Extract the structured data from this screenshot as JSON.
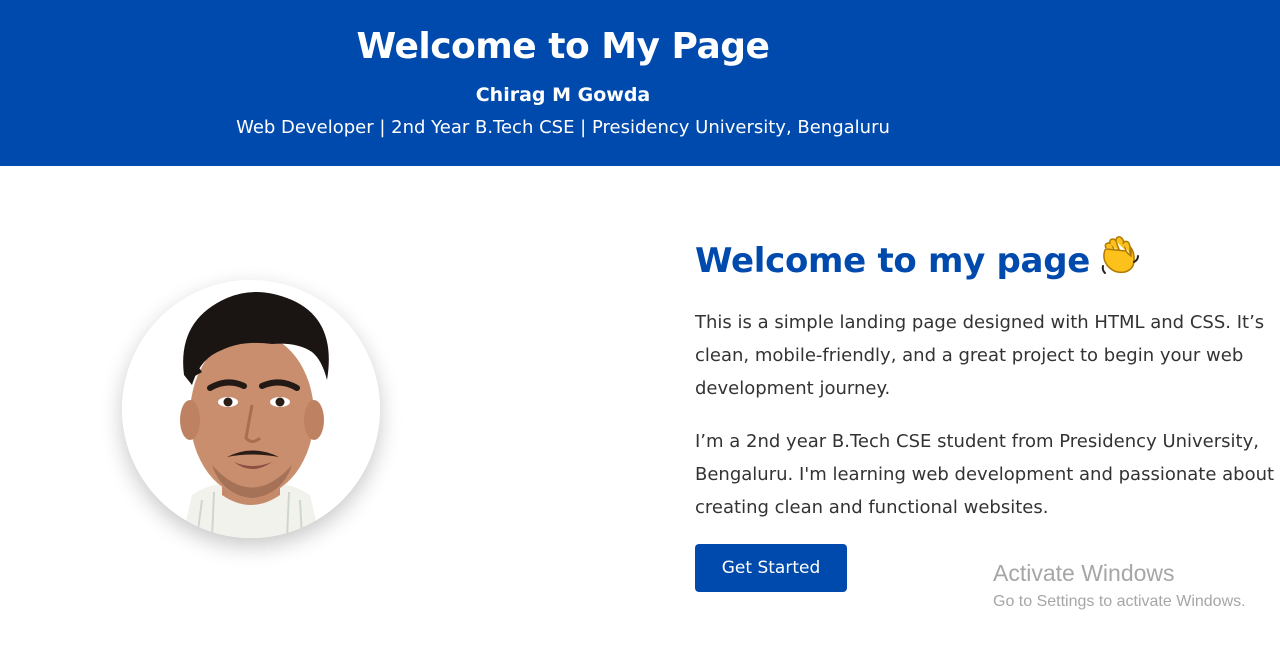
{
  "header": {
    "title": "Welcome to My Page",
    "name": "Chirag M Gowda",
    "tagline": "Web Developer | 2nd Year B.Tech CSE | Presidency University, Bengaluru"
  },
  "main": {
    "avatar_icon": "profile-photo",
    "heading": "Welcome to my page",
    "heading_emoji": "waving-hand-icon",
    "paragraph_1": "This is a simple landing page designed with HTML and CSS. It’s clean, mobile-friendly, and a great project to begin your web development journey.",
    "paragraph_2": "I’m a 2nd year B.Tech CSE student from Presidency University, Bengaluru. I'm learning web development and passionate about creating clean and functional websites.",
    "cta_label": "Get Started"
  },
  "watermark": {
    "title": "Activate Windows",
    "subtitle": "Go to Settings to activate Windows."
  },
  "colors": {
    "brand_blue": "#004aad",
    "text": "#333333",
    "watermark": "#a6a6a6"
  }
}
